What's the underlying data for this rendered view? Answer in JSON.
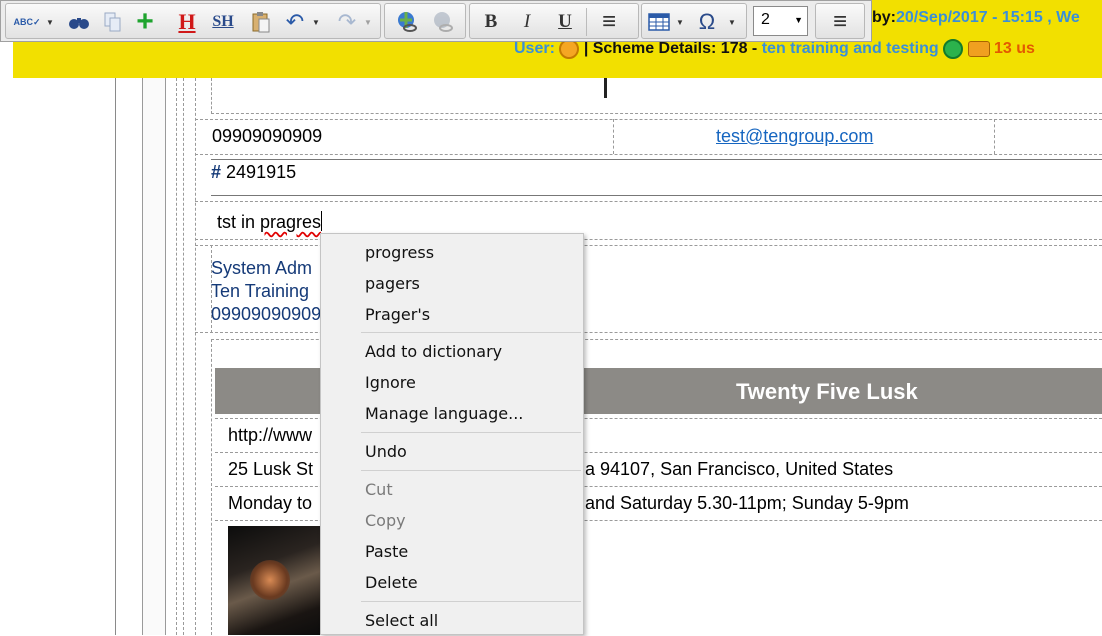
{
  "header": {
    "by_label": "by:",
    "datetime": "20/Sep/2017 - 15:15 , We",
    "user_label": "User:",
    "scheme_label": "| Scheme Details: 178 -",
    "scheme_name": "ten training and testing",
    "users_online": "13 us"
  },
  "toolbar": {
    "spellcheck": "ABC✓",
    "find": "find",
    "copy": "copy",
    "add": "+",
    "heading": "H",
    "subheading": "SH",
    "paste": "paste",
    "undo": "↶",
    "redo": "↷",
    "link": "link",
    "unlink": "unlink",
    "bold": "B",
    "italic": "I",
    "underline": "U",
    "list": "≡",
    "table": "table",
    "special_char": "Ω",
    "font_size": "2",
    "align": "≡"
  },
  "document": {
    "phone": "09909090909",
    "email": "test@tengroup.com",
    "hash_label": "#",
    "ref_number": "2491915",
    "note_before": "tst in ",
    "note_misspelled": "pragres",
    "signature_name": "System Adm",
    "signature_company": "Ten Training",
    "signature_phone": "09909090909",
    "venue_title": "Twenty Five Lusk",
    "venue_url": "http://www",
    "venue_address_start": "25 Lusk St",
    "venue_address_end": "a 94107, San Francisco, United States",
    "venue_hours_start": "Monday to",
    "venue_hours_end": "and Saturday 5.30-11pm; Sunday 5-9pm"
  },
  "context_menu": {
    "suggestions": [
      "progress",
      "pagers",
      "Prager's"
    ],
    "add_to_dictionary": "Add to dictionary",
    "ignore": "Ignore",
    "manage_language": "Manage language...",
    "undo": "Undo",
    "cut": "Cut",
    "copy": "Copy",
    "paste": "Paste",
    "delete": "Delete",
    "select_all": "Select all"
  },
  "colors": {
    "header_bg": "#f2e000",
    "header_accent": "#3a8fd8",
    "banner_bg": "#8c8a86",
    "link": "#1565c0",
    "signature": "#153a78"
  }
}
